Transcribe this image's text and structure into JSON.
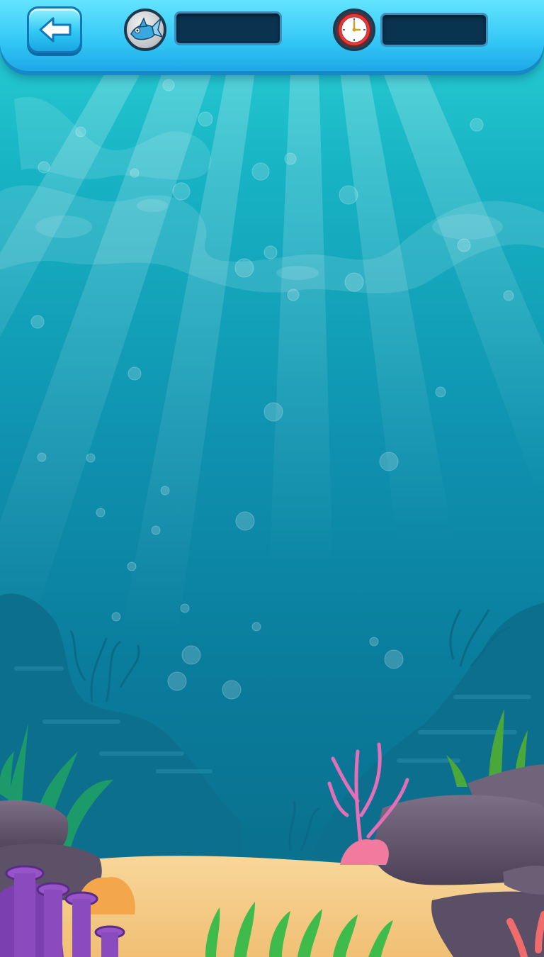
{
  "hud": {
    "back_button_icon": "back-arrow-icon",
    "fish_icon": "fish-icon",
    "fish_count": "",
    "clock_icon": "clock-icon",
    "time_value": ""
  },
  "colors": {
    "bar_top": "#62e4ff",
    "bar_bottom": "#1ca7e6",
    "counter_bg": "#0a3350",
    "water_light": "#2ad3d6",
    "water_deep": "#0a6b88",
    "sand": "#f6cf8c"
  }
}
